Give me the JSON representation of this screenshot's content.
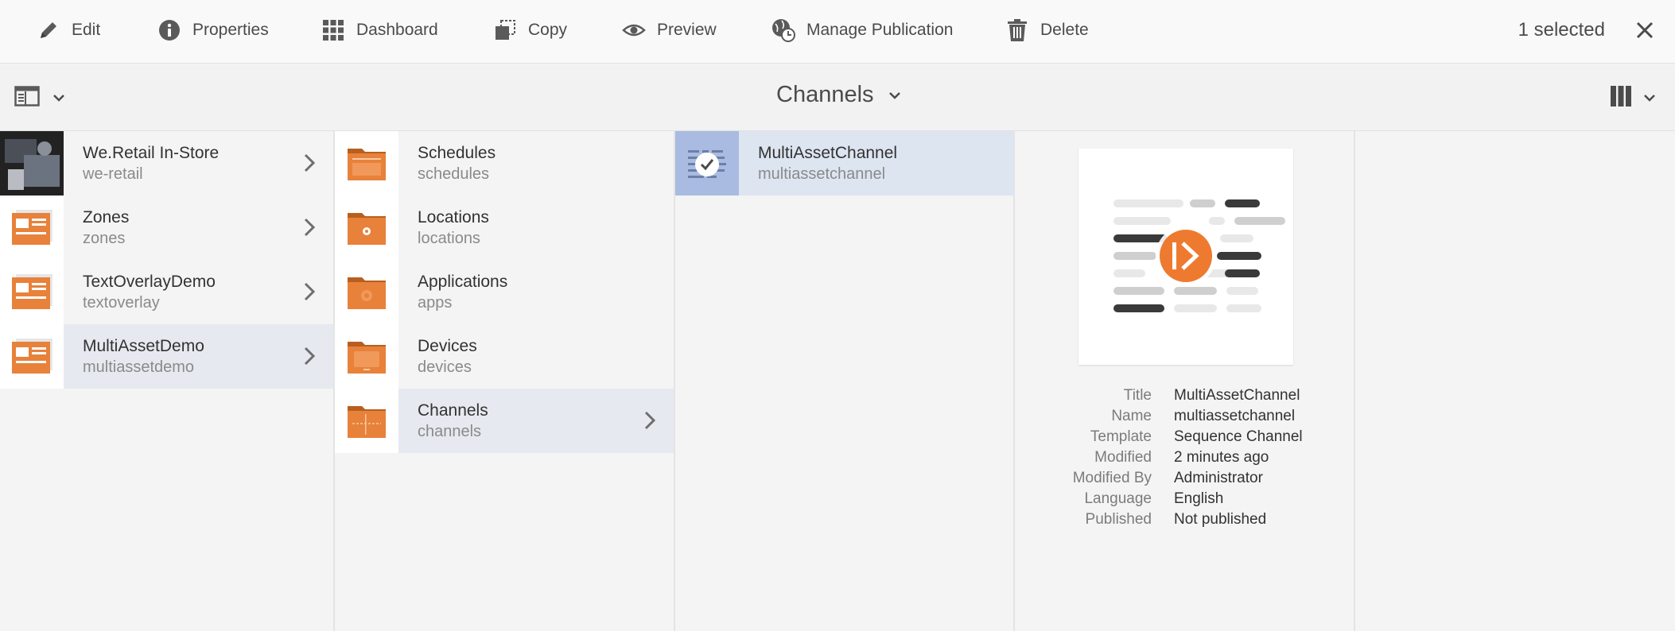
{
  "actionbar": {
    "actions": [
      {
        "label": "Edit",
        "icon": "pencil-icon"
      },
      {
        "label": "Properties",
        "icon": "info-icon"
      },
      {
        "label": "Dashboard",
        "icon": "grid-icon"
      },
      {
        "label": "Copy",
        "icon": "copy-icon"
      },
      {
        "label": "Preview",
        "icon": "eye-icon"
      },
      {
        "label": "Manage Publication",
        "icon": "globe-clock-icon"
      },
      {
        "label": "Delete",
        "icon": "trash-icon"
      }
    ],
    "selection": "1 selected"
  },
  "titlebar": {
    "title": "Channels"
  },
  "columns": {
    "col1": [
      {
        "title": "We.Retail In-Store",
        "name": "we-retail"
      },
      {
        "title": "Zones",
        "name": "zones"
      },
      {
        "title": "TextOverlayDemo",
        "name": "textoverlay"
      },
      {
        "title": "MultiAssetDemo",
        "name": "multiassetdemo"
      }
    ],
    "col2": [
      {
        "title": "Schedules",
        "name": "schedules"
      },
      {
        "title": "Locations",
        "name": "locations"
      },
      {
        "title": "Applications",
        "name": "apps"
      },
      {
        "title": "Devices",
        "name": "devices"
      },
      {
        "title": "Channels",
        "name": "channels"
      }
    ],
    "col3": [
      {
        "title": "MultiAssetChannel",
        "name": "multiassetchannel"
      }
    ]
  },
  "preview": {
    "meta": [
      {
        "key": "Title",
        "value": "MultiAssetChannel"
      },
      {
        "key": "Name",
        "value": "multiassetchannel"
      },
      {
        "key": "Template",
        "value": "Sequence Channel"
      },
      {
        "key": "Modified",
        "value": "2 minutes ago"
      },
      {
        "key": "Modified By",
        "value": "Administrator"
      },
      {
        "key": "Language",
        "value": "English"
      },
      {
        "key": "Published",
        "value": "Not published"
      }
    ]
  },
  "colors": {
    "folder_orange": "#e8813a",
    "active_row": "#e6e9ef",
    "selected_row": "#dde5f1",
    "accent_orange": "#ee7a30"
  }
}
